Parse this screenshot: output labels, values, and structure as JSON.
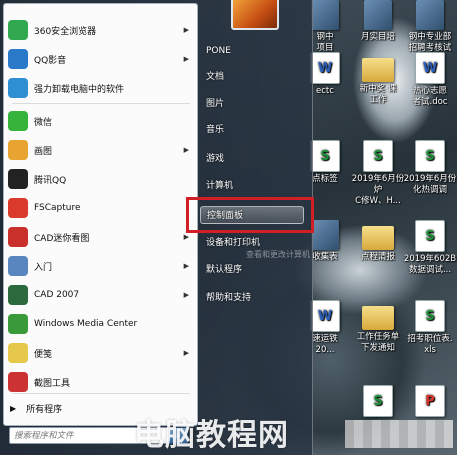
{
  "start_menu": {
    "programs": [
      {
        "label": "360安全浏览器",
        "icon": "browser-360-icon",
        "color": "#2fa84f",
        "has_arrow": true
      },
      {
        "label": "QQ影音",
        "icon": "qq-player-icon",
        "color": "#2b79c9",
        "has_arrow": true
      },
      {
        "label": "强力卸载电脑中的软件",
        "icon": "uninstall-icon",
        "color": "#2f8fd3",
        "has_arrow": false
      },
      {
        "label": "微信",
        "icon": "wechat-icon",
        "color": "#35b33a",
        "has_arrow": false
      },
      {
        "label": "画图",
        "icon": "paint-icon",
        "color": "#e8a431",
        "has_arrow": true
      },
      {
        "label": "腾讯QQ",
        "icon": "qq-icon",
        "color": "#222222",
        "has_arrow": false
      },
      {
        "label": "FSCapture",
        "icon": "fscapture-icon",
        "color": "#d93a2b",
        "has_arrow": false
      },
      {
        "label": "CAD迷你看图",
        "icon": "cad-mini-icon",
        "color": "#c9302c",
        "has_arrow": true
      },
      {
        "label": "入门",
        "icon": "getting-started-icon",
        "color": "#5a86c0",
        "has_arrow": true
      },
      {
        "label": "CAD 2007",
        "icon": "autocad-icon",
        "color": "#2c6a3e",
        "has_arrow": true
      },
      {
        "label": "Windows Media Center",
        "icon": "media-center-icon",
        "color": "#3a9a3a",
        "has_arrow": false
      },
      {
        "label": "便笺",
        "icon": "sticky-notes-icon",
        "color": "#e6c84a",
        "has_arrow": true
      },
      {
        "label": "截图工具",
        "icon": "snipping-tool-icon",
        "color": "#c33",
        "has_arrow": false
      }
    ],
    "all_programs": "所有程序",
    "search_placeholder": "搜索程序和文件",
    "search_icon": "magnifier-icon",
    "right_items": [
      {
        "label": "PONE",
        "has_arrow": false,
        "active": false
      },
      {
        "label": "文档",
        "has_arrow": false,
        "active": false
      },
      {
        "label": "图片",
        "has_arrow": false,
        "active": false
      },
      {
        "label": "音乐",
        "has_arrow": false,
        "active": false
      },
      {
        "label": "游戏",
        "has_arrow": false,
        "active": false
      },
      {
        "label": "计算机",
        "has_arrow": false,
        "active": false
      },
      {
        "label": "控制面板",
        "has_arrow": false,
        "active": true
      },
      {
        "label": "设备和打印机",
        "has_arrow": false,
        "active": false
      },
      {
        "label": "默认程序",
        "has_arrow": false,
        "active": false
      },
      {
        "label": "帮助和支持",
        "has_arrow": false,
        "active": false
      }
    ],
    "ghost_text": "查看和更改计算机"
  },
  "desktop_icons": [
    {
      "label": "钢中\n项目",
      "kind": "img"
    },
    {
      "label": "月实目培",
      "kind": "img"
    },
    {
      "label": "钢中专业部\n招聘考核试",
      "kind": "img"
    },
    {
      "label": "ectc",
      "kind": "word"
    },
    {
      "label": "新中奖 课\n工作",
      "kind": "folder"
    },
    {
      "label": "热心志愿\n者试.doc",
      "kind": "word"
    },
    {
      "label": "点标签",
      "kind": "excel"
    },
    {
      "label": "2019年6月份炉\nC修W、H...",
      "kind": "excel"
    },
    {
      "label": "2019年6月份\n化热调调",
      "kind": "excel"
    },
    {
      "label": "收集表",
      "kind": "img"
    },
    {
      "label": "点程清报",
      "kind": "folder"
    },
    {
      "label": "2019年602B\n数据调试...",
      "kind": "excel"
    },
    {
      "label": "速运铁\n20...",
      "kind": "word"
    },
    {
      "label": "工作任务单\n下发通知",
      "kind": "folder"
    },
    {
      "label": "招考职位表.\nxls",
      "kind": "excel"
    },
    {
      "label": "",
      "kind": "excel"
    },
    {
      "label": "",
      "kind": "pdf"
    }
  ],
  "watermark": "电脑教程网"
}
